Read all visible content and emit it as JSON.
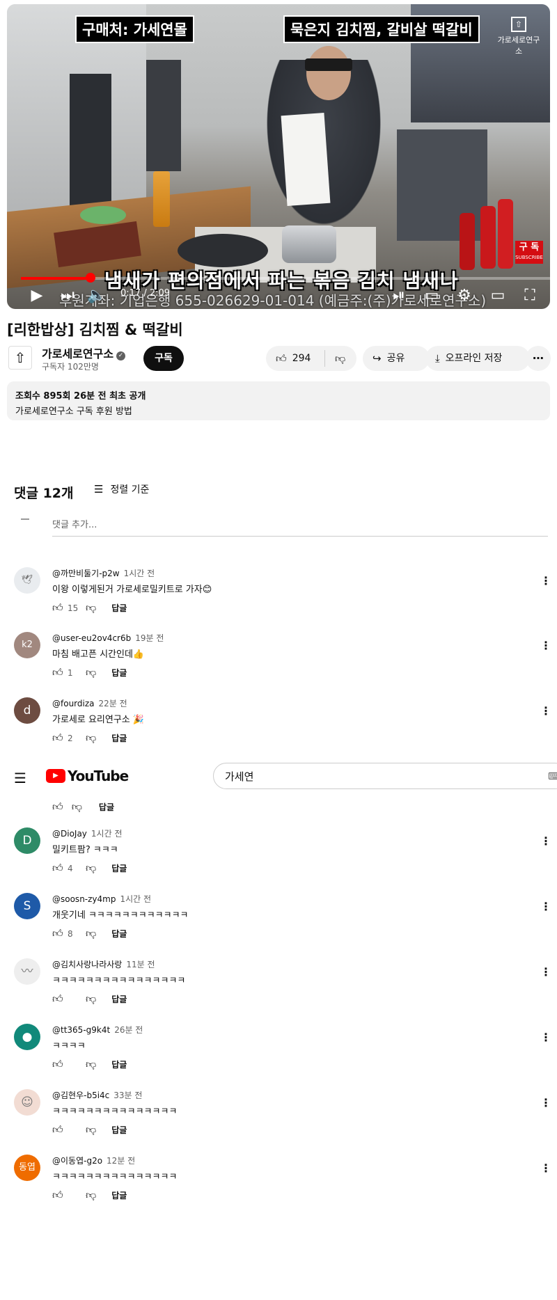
{
  "video": {
    "tag_left": "구매처: 가세연몰",
    "tag_right": "묵은지 김치찜, 갈비살 떡갈비",
    "channel_logo_text": "가로세로연구소",
    "subscribe_badge": "구 독",
    "subscribe_badge_small": "SUBSCRIBE",
    "subtitle": "냄새가 편의점에서 파는 볶음 김치 냄새나",
    "account_line": "후원계좌: 기업은행 655-026629-01-014 (예금주:(주)가로세로연구소)",
    "time": "0:17 / 2:09",
    "progress_fraction": 0.132
  },
  "title": "[리한밥상] 김치찜 & 떡갈비",
  "channel": {
    "avatar": "⇧",
    "name": "가로세로연구소",
    "subs": "구독자 102만명",
    "subscribe_label": "구독"
  },
  "actions": {
    "likes": "294",
    "share": "공유",
    "download": "오프라인 저장",
    "more": "⋯"
  },
  "description": {
    "stats": "조회수 895회  26분 전 최초 공개",
    "text": "가로세로연구소 구독 후원 방법"
  },
  "comments_header": {
    "count": "댓글 12개",
    "sort": "정렬 기준",
    "add_placeholder": "댓글 추가..."
  },
  "comments": [
    {
      "author": "@까만비둘기-p2w",
      "time": "1시간 전",
      "text": "이왕 이렇게된거 가로세로밀키트로 가자😊",
      "likes": "15",
      "avatar": "🕊",
      "color": "#e9ecef"
    },
    {
      "author": "@user-eu2ov4cr6b",
      "time": "19분 전",
      "text": "마침 배고픈 시간인데👍",
      "likes": "1",
      "avatar": "k2",
      "color": "#a1887f"
    },
    {
      "author": "@fourdiza",
      "time": "22분 전",
      "text": "가로세로 요리연구소 🎉",
      "likes": "2",
      "avatar": "d",
      "color": "#6d4c41"
    },
    {
      "author": "@DioJay",
      "time": "1시간 전",
      "text": "밀키트팜? ㅋㅋㅋ",
      "likes": "4",
      "avatar": "D",
      "color": "#2e8b67"
    },
    {
      "author": "@soosn-zy4mp",
      "time": "1시간 전",
      "text": "개웃기네 ㅋㅋㅋㅋㅋㅋㅋㅋㅋㅋㅋㅋ",
      "likes": "8",
      "avatar": "S",
      "color": "#1e5aa8"
    },
    {
      "author": "@김치사랑나라사랑",
      "time": "11분 전",
      "text": "ㅋㅋㅋㅋㅋㅋㅋㅋㅋㅋㅋㅋㅋㅋㅋㅋ",
      "likes": "",
      "avatar": "〰",
      "color": "#eeeeee"
    },
    {
      "author": "@tt365-g9k4t",
      "time": "26분 전",
      "text": "ㅋㅋㅋㅋ",
      "likes": "",
      "avatar": "●",
      "color": "#11897a"
    },
    {
      "author": "@김현우-b5i4c",
      "time": "33분 전",
      "text": "ㅋㅋㅋㅋㅋㅋㅋㅋㅋㅋㅋㅋㅋㅋㅋ",
      "likes": "",
      "avatar": "☺",
      "color": "#f2dcd3"
    },
    {
      "author": "@이동엽-g2o",
      "time": "12분 전",
      "text": "ㅋㅋㅋㅋㅋㅋㅋㅋㅋㅋㅋㅋㅋㅋㅋ",
      "likes": "",
      "avatar": "동엽",
      "color": "#ef6c00"
    }
  ],
  "reply_label": "답글",
  "header_overlay": {
    "logo_text": "YouTube",
    "search_value": "가세연"
  }
}
